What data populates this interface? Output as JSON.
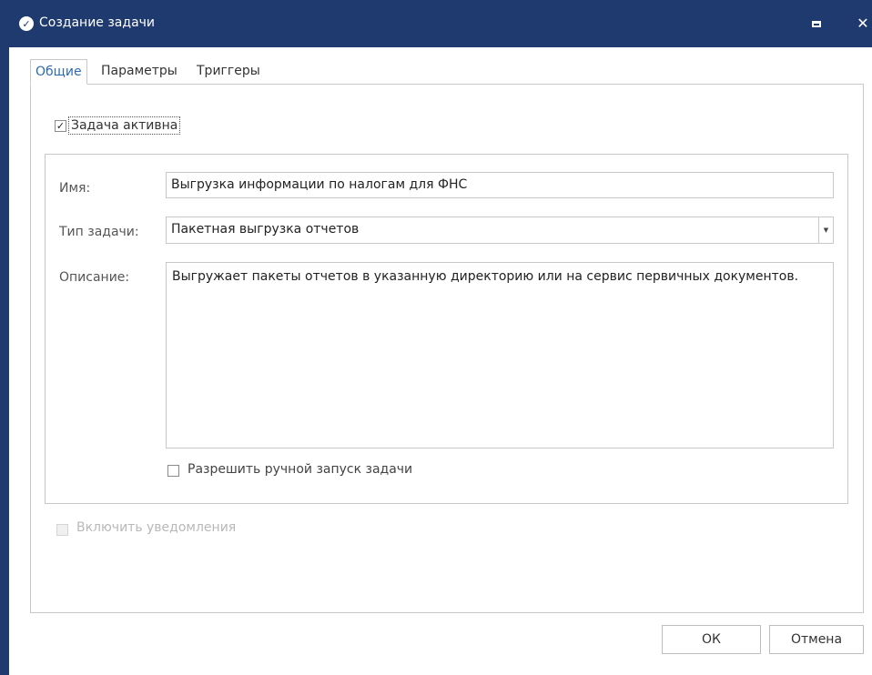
{
  "window": {
    "title": "Создание задачи",
    "close_glyph": "✕",
    "accent_color": "#1e3a6e"
  },
  "tabs": [
    {
      "label": "Общие",
      "active": true
    },
    {
      "label": "Параметры",
      "active": false
    },
    {
      "label": "Триггеры",
      "active": false
    }
  ],
  "general": {
    "task_active": {
      "label": "Задача активна",
      "checked": true
    },
    "name": {
      "label": "Имя:",
      "value": "Выгрузка информации по налогам для ФНС"
    },
    "task_type": {
      "label": "Тип задачи:",
      "value": "Пакетная выгрузка отчетов"
    },
    "description": {
      "label": "Описание:",
      "value": "Выгружает пакеты отчетов в указанную директорию или на сервис первичных документов."
    },
    "manual_start": {
      "label": "Разрешить ручной запуск задачи",
      "checked": false
    },
    "notifications": {
      "label": "Включить уведомления",
      "checked": false,
      "disabled": true
    }
  },
  "footer": {
    "ok_label": "ОК",
    "cancel_label": "Отмена"
  }
}
